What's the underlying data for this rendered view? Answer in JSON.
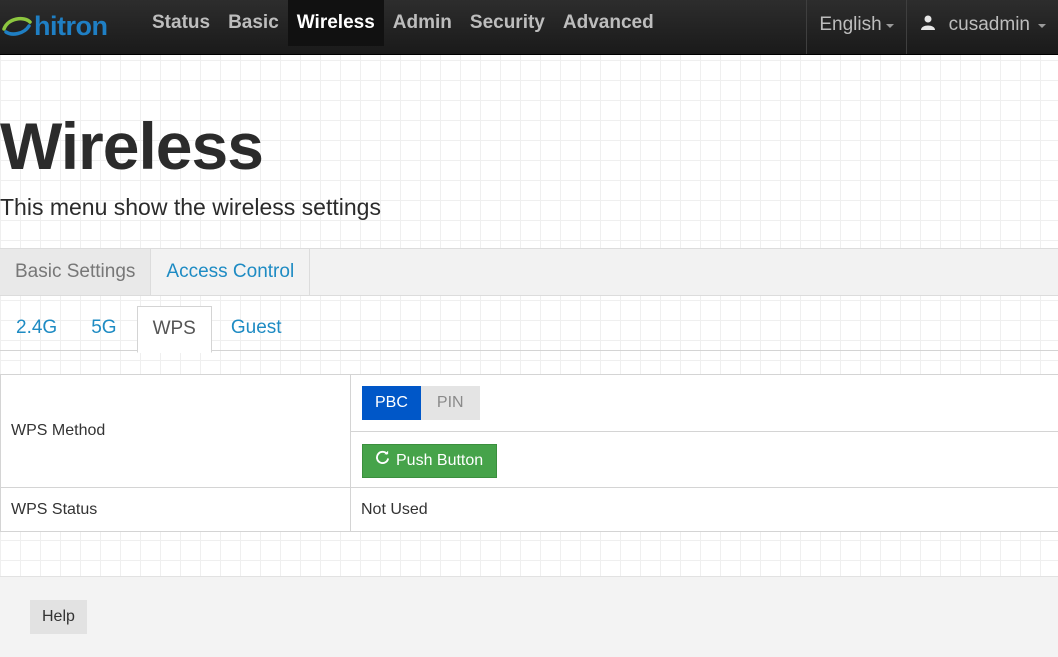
{
  "navbar": {
    "logo_text": "hitron",
    "items": [
      {
        "label": "Status"
      },
      {
        "label": "Basic"
      },
      {
        "label": "Wireless",
        "active": true
      },
      {
        "label": "Admin"
      },
      {
        "label": "Security"
      },
      {
        "label": "Advanced"
      }
    ],
    "language": "English",
    "user": "cusadmin",
    "icons": {
      "user": "user-icon",
      "caret": "chevron-down-icon"
    }
  },
  "header": {
    "title": "Wireless",
    "subtitle": "This menu show the wireless settings"
  },
  "main_tabs": [
    {
      "label": "Basic Settings",
      "active": true
    },
    {
      "label": "Access Control"
    }
  ],
  "sub_tabs": [
    {
      "label": "2.4G"
    },
    {
      "label": "5G"
    },
    {
      "label": "WPS",
      "active": true
    },
    {
      "label": "Guest"
    }
  ],
  "wps": {
    "method_label": "WPS Method",
    "method_options": [
      {
        "label": "PBC",
        "selected": true
      },
      {
        "label": "PIN"
      }
    ],
    "push_button_label": "Push Button",
    "push_button_icon": "refresh-icon",
    "status_label": "WPS Status",
    "status_value": "Not Used"
  },
  "footer": {
    "help_label": "Help"
  },
  "colors": {
    "navbar_bg": "#1e1e1e",
    "link": "#1e8bc3",
    "selected_segment": "#0057c8",
    "push_button": "#46a34a"
  }
}
